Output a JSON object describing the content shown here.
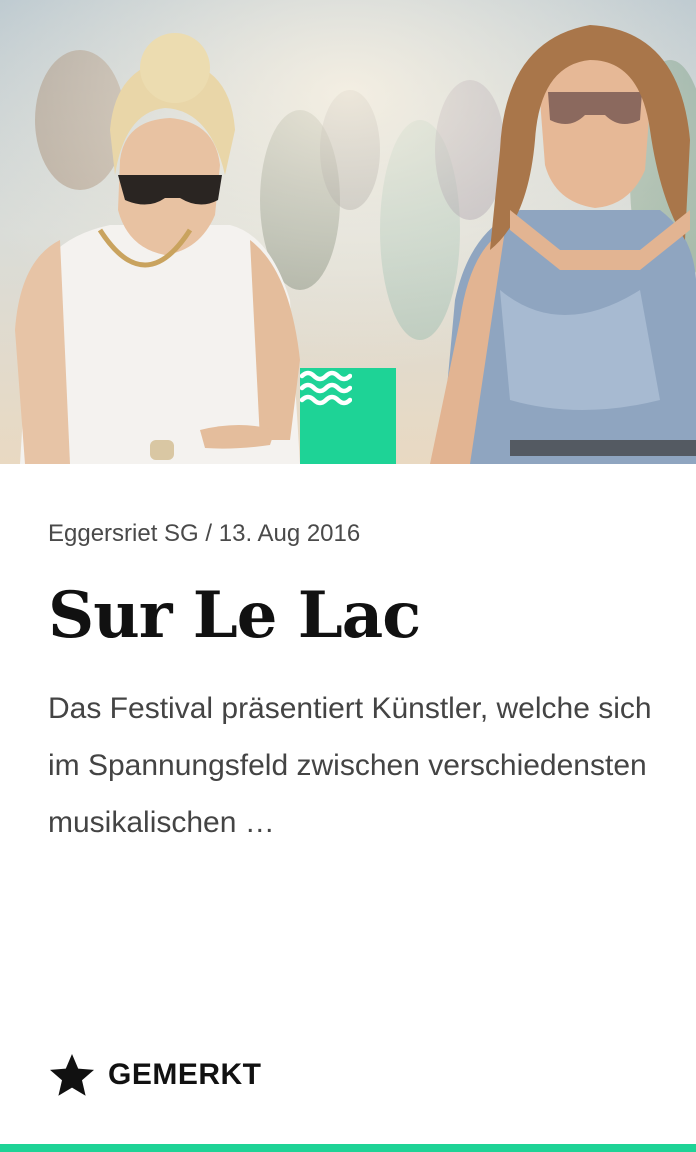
{
  "event": {
    "location": "Eggersriet SG",
    "separator": "/",
    "date": "13. Aug 2016",
    "title": "Sur Le Lac",
    "description": "Das Festival präsentiert Künstler, welche sich im Spannungsfeld zwischen verschiedensten musikalischen …",
    "category_icon": "waves-icon"
  },
  "actions": {
    "bookmark_label": "GEMERKT",
    "bookmark_icon": "star-icon"
  },
  "colors": {
    "accent": "#1ed396",
    "title": "#111111",
    "text": "#444444"
  }
}
